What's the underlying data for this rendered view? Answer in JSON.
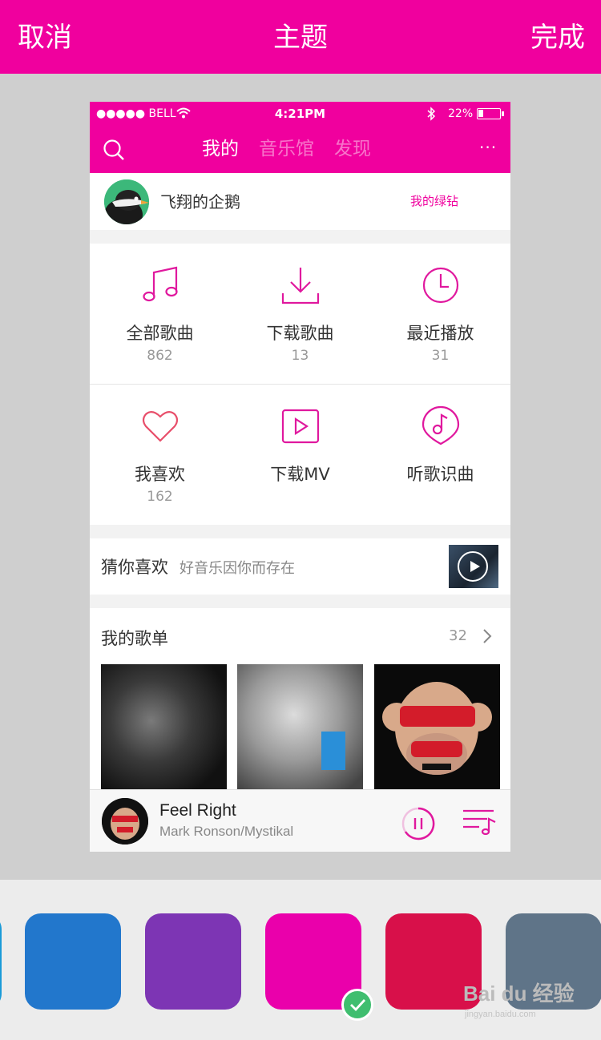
{
  "topbar": {
    "cancel": "取消",
    "title": "主题",
    "done": "完成"
  },
  "colors": {
    "theme_accent": "#f0009e",
    "check_green": "#3fbe6f"
  },
  "statusbar": {
    "carrier": "●●●●● BELL",
    "time": "4:21PM",
    "battery": "22%"
  },
  "tabs": [
    {
      "label": "我的"
    },
    {
      "label": "音乐馆"
    },
    {
      "label": "发现"
    }
  ],
  "more_label": "···",
  "user": {
    "name": "飞翔的企鹅",
    "vip_link": "我的绿钻"
  },
  "grid": [
    {
      "label": "全部歌曲",
      "count": "862",
      "icon": "music-note-icon"
    },
    {
      "label": "下载歌曲",
      "count": "13",
      "icon": "download-icon"
    },
    {
      "label": "最近播放",
      "count": "31",
      "icon": "clock-icon"
    },
    {
      "label": "我喜欢",
      "count": "162",
      "icon": "heart-icon"
    },
    {
      "label": "下载MV",
      "count": "",
      "icon": "video-play-icon"
    },
    {
      "label": "听歌识曲",
      "count": "",
      "icon": "music-recognition-icon"
    }
  ],
  "guess": {
    "title": "猜你喜欢",
    "subtitle": "好音乐因你而存在"
  },
  "playlists": {
    "title": "我的歌单",
    "count": "32"
  },
  "now_playing": {
    "title": "Feel Right",
    "artist": "Mark Ronson/Mystikal"
  },
  "swatches": [
    {
      "name": "blue",
      "color": "#2277cc"
    },
    {
      "name": "purple",
      "color": "#7d35b4"
    },
    {
      "name": "magenta",
      "color": "#ea00ab",
      "selected": true
    },
    {
      "name": "crimson",
      "color": "#d8104a"
    },
    {
      "name": "slate",
      "color": "#5f7488"
    }
  ],
  "watermark": {
    "logo": "Bai du 经验",
    "url": "jingyan.baidu.com"
  }
}
